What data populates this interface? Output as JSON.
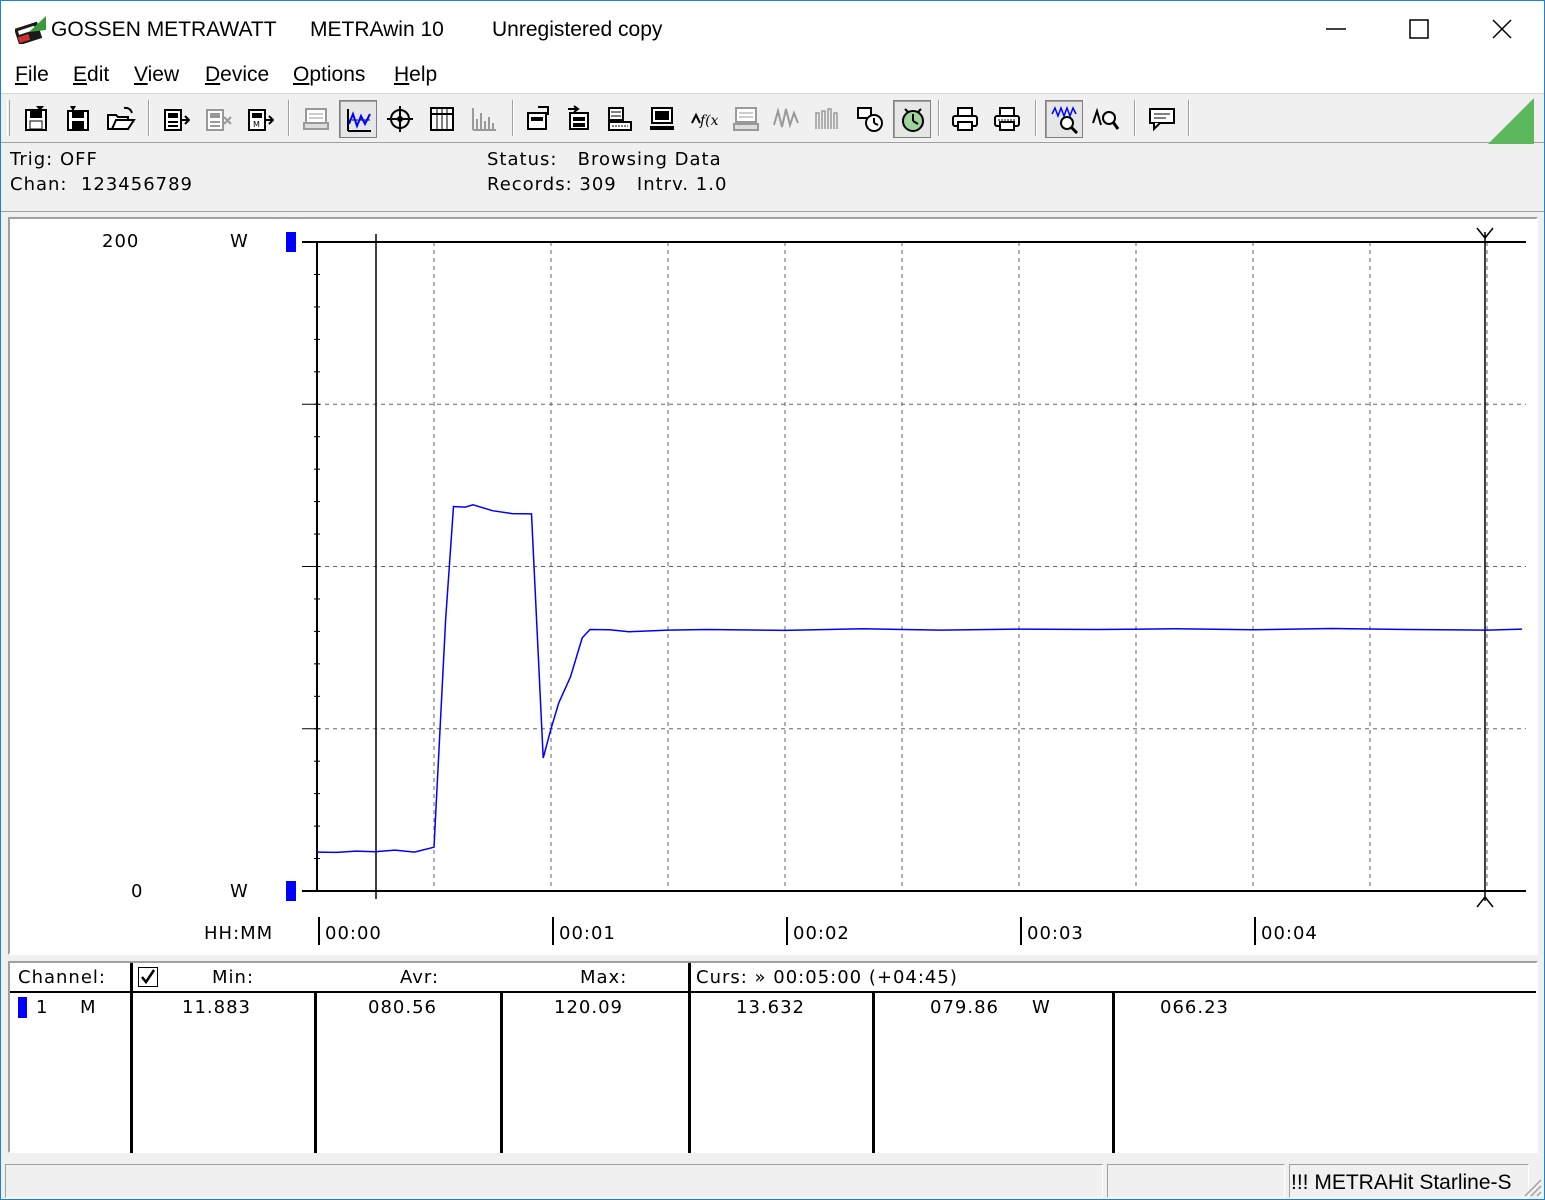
{
  "titlebar": {
    "brand": "GOSSEN METRAWATT",
    "app_name": "METRAwin 10",
    "registration": "Unregistered copy",
    "minimize_icon": "minimize-icon",
    "maximize_icon": "maximize-icon",
    "close_icon": "close-icon"
  },
  "menu": {
    "file": {
      "accel": "F",
      "rest": "ile"
    },
    "edit": {
      "accel": "E",
      "rest": "dit"
    },
    "view": {
      "accel": "V",
      "rest": "iew"
    },
    "device": {
      "accel": "D",
      "rest": "evice"
    },
    "options": {
      "accel": "O",
      "rest": "ptions"
    },
    "help": {
      "accel": "H",
      "rest": "elp"
    }
  },
  "toolbar": {
    "buttons": [
      "save-icon",
      "save-as-icon",
      "open-icon",
      "device-read-icon",
      "device-clear-icon",
      "device-memory-icon",
      "online-list-icon",
      "online-chart-icon",
      "scope-icon",
      "table-icon",
      "histogram-icon",
      "export-icon",
      "import-icon",
      "data-sheet-icon",
      "monitor-icon",
      "function-icon",
      "keyboard-icon",
      "waveform-icon",
      "signal-icon",
      "link-icon",
      "timer-icon",
      "print-icon",
      "print-preview-icon",
      "zoom-wave-icon",
      "zoom-icon",
      "message-icon"
    ]
  },
  "status": {
    "trig_label": "Trig:",
    "trig_value": "OFF",
    "chan_label": "Chan:",
    "chan_value": "123456789",
    "status_label": "Status:",
    "status_value": "Browsing Data",
    "records_label": "Records:",
    "records_value": "309",
    "interval_label": "Intrv.",
    "interval_value": "1.0"
  },
  "chart_data": {
    "type": "line",
    "title": "",
    "xlabel": "HH:MM",
    "ylabel": "W",
    "ylim": [
      0,
      200
    ],
    "y_top_label": "200",
    "y_bottom_label": "0",
    "y_unit_top": "W",
    "y_unit_bottom": "W",
    "x_ticks": [
      "00:00",
      "00:01",
      "00:02",
      "00:03",
      "00:04"
    ],
    "xlim_seconds": [
      0,
      309
    ],
    "grid": true,
    "series": [
      {
        "color": "#0000ff",
        "x": [
          0,
          5,
          10,
          15,
          20,
          25,
          30,
          33,
          35,
          38,
          40,
          45,
          50,
          55,
          58,
          60,
          62,
          65,
          68,
          70,
          75,
          80,
          90,
          100,
          120,
          140,
          160,
          180,
          200,
          220,
          240,
          260,
          280,
          300,
          309
        ],
        "y": [
          12.0,
          11.9,
          12.3,
          12.1,
          12.6,
          12.0,
          13.5,
          84,
          118.5,
          118.3,
          119.0,
          117.2,
          116.3,
          116.2,
          41,
          50,
          58,
          66,
          78,
          80.6,
          80.5,
          79.9,
          80.4,
          80.6,
          80.3,
          80.8,
          80.4,
          80.7,
          80.6,
          80.8,
          80.5,
          80.9,
          80.6,
          80.4,
          80.7
        ]
      }
    ],
    "cursor_seconds": 300
  },
  "table": {
    "headers": {
      "channel": "Channel:",
      "min": "Min:",
      "avr": "Avr:",
      "max": "Max:",
      "curs": "Curs: » 00:05:00 (+04:45)"
    },
    "rows": [
      {
        "channel": "1",
        "mode": "M",
        "min": "11.883",
        "avr": "080.56",
        "max": "120.09",
        "curs_value": "13.632",
        "curs_value2": "079.86",
        "unit": "W",
        "curs_value3": "066.23",
        "color": "#0000ff"
      }
    ]
  },
  "statusbar": {
    "device": "!!! METRAHit Starline-S"
  }
}
